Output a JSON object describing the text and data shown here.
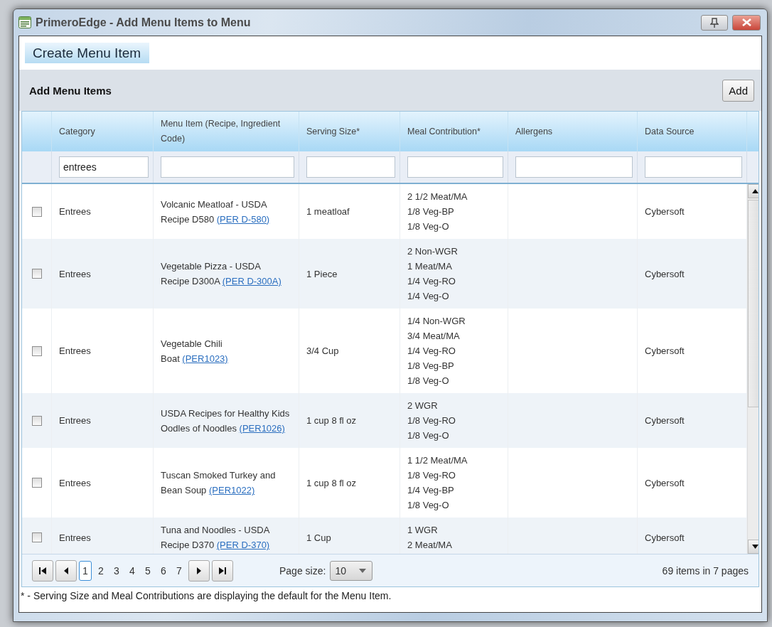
{
  "window": {
    "title": "PrimeroEdge - Add Menu Items to Menu"
  },
  "section_tab": {
    "label": "Create Menu Item"
  },
  "toolbar": {
    "title": "Add Menu Items",
    "button": "Add"
  },
  "columns": [
    {
      "label": "Category",
      "filter": "entrees"
    },
    {
      "label": "Menu Item (Recipe, Ingredient Code)"
    },
    {
      "label": "Serving Size*"
    },
    {
      "label": "Meal Contribution*"
    },
    {
      "label": "Allergens"
    },
    {
      "label": "Data Source"
    }
  ],
  "rows": [
    {
      "checked": false,
      "category": "Entrees",
      "name": "Volcanic Meatloaf - USDA Recipe D580",
      "code": "(PER D-580)",
      "serving": "1 meatloaf",
      "meal": [
        "2 1/2 Meat/MA",
        "1/8 Veg-BP",
        "1/8 Veg-O"
      ],
      "source": "Cybersoft"
    },
    {
      "checked": false,
      "category": "Entrees",
      "name": "Vegetable Pizza - USDA Recipe D300A",
      "code": "(PER D-300A)",
      "serving": "1 Piece",
      "meal": [
        "2 Non-WGR",
        "1 Meat/MA",
        "1/4 Veg-RO",
        "1/4 Veg-O"
      ],
      "source": "Cybersoft"
    },
    {
      "checked": false,
      "category": "Entrees",
      "name": "Vegetable Chili Boat",
      "code": "(PER1023)",
      "serving": "3/4 Cup",
      "meal": [
        "1/4 Non-WGR",
        "3/4 Meat/MA",
        "1/4 Veg-RO",
        "1/8 Veg-BP",
        "1/8 Veg-O"
      ],
      "source": "Cybersoft"
    },
    {
      "checked": false,
      "category": "Entrees",
      "name": "USDA Recipes for Healthy Kids Oodles of Noodles",
      "code": "(PER1026)",
      "serving": "1 cup 8 fl oz",
      "meal": [
        "2 WGR",
        "1/8 Veg-RO",
        "1/8 Veg-O"
      ],
      "source": "Cybersoft"
    },
    {
      "checked": false,
      "category": "Entrees",
      "name": "Tuscan Smoked Turkey and Bean Soup",
      "code": "(PER1022)",
      "serving": "1 cup 8 fl oz",
      "meal": [
        "1 1/2 Meat/MA",
        "1/8 Veg-RO",
        "1/4 Veg-BP",
        "1/8 Veg-O"
      ],
      "source": "Cybersoft"
    },
    {
      "checked": false,
      "category": "Entrees",
      "name": "Tuna and Noodles - USDA Recipe D370",
      "code": "(PER D-370)",
      "serving": "1 Cup",
      "meal": [
        "1 WGR",
        "2 Meat/MA"
      ],
      "source": "Cybersoft"
    }
  ],
  "pager": {
    "pages": [
      {
        "label": "1",
        "selected": true
      },
      {
        "label": "2",
        "selected": false
      },
      {
        "label": "3",
        "selected": false
      },
      {
        "label": "4",
        "selected": false
      },
      {
        "label": "5",
        "selected": false
      },
      {
        "label": "6",
        "selected": false
      },
      {
        "label": "7",
        "selected": false
      }
    ],
    "page_size_label": "Page size:",
    "page_size": "10",
    "summary": "69 items in 7 pages"
  },
  "footnote": "* - Serving Size and Meal Contributions are displaying the default for the Menu Item."
}
